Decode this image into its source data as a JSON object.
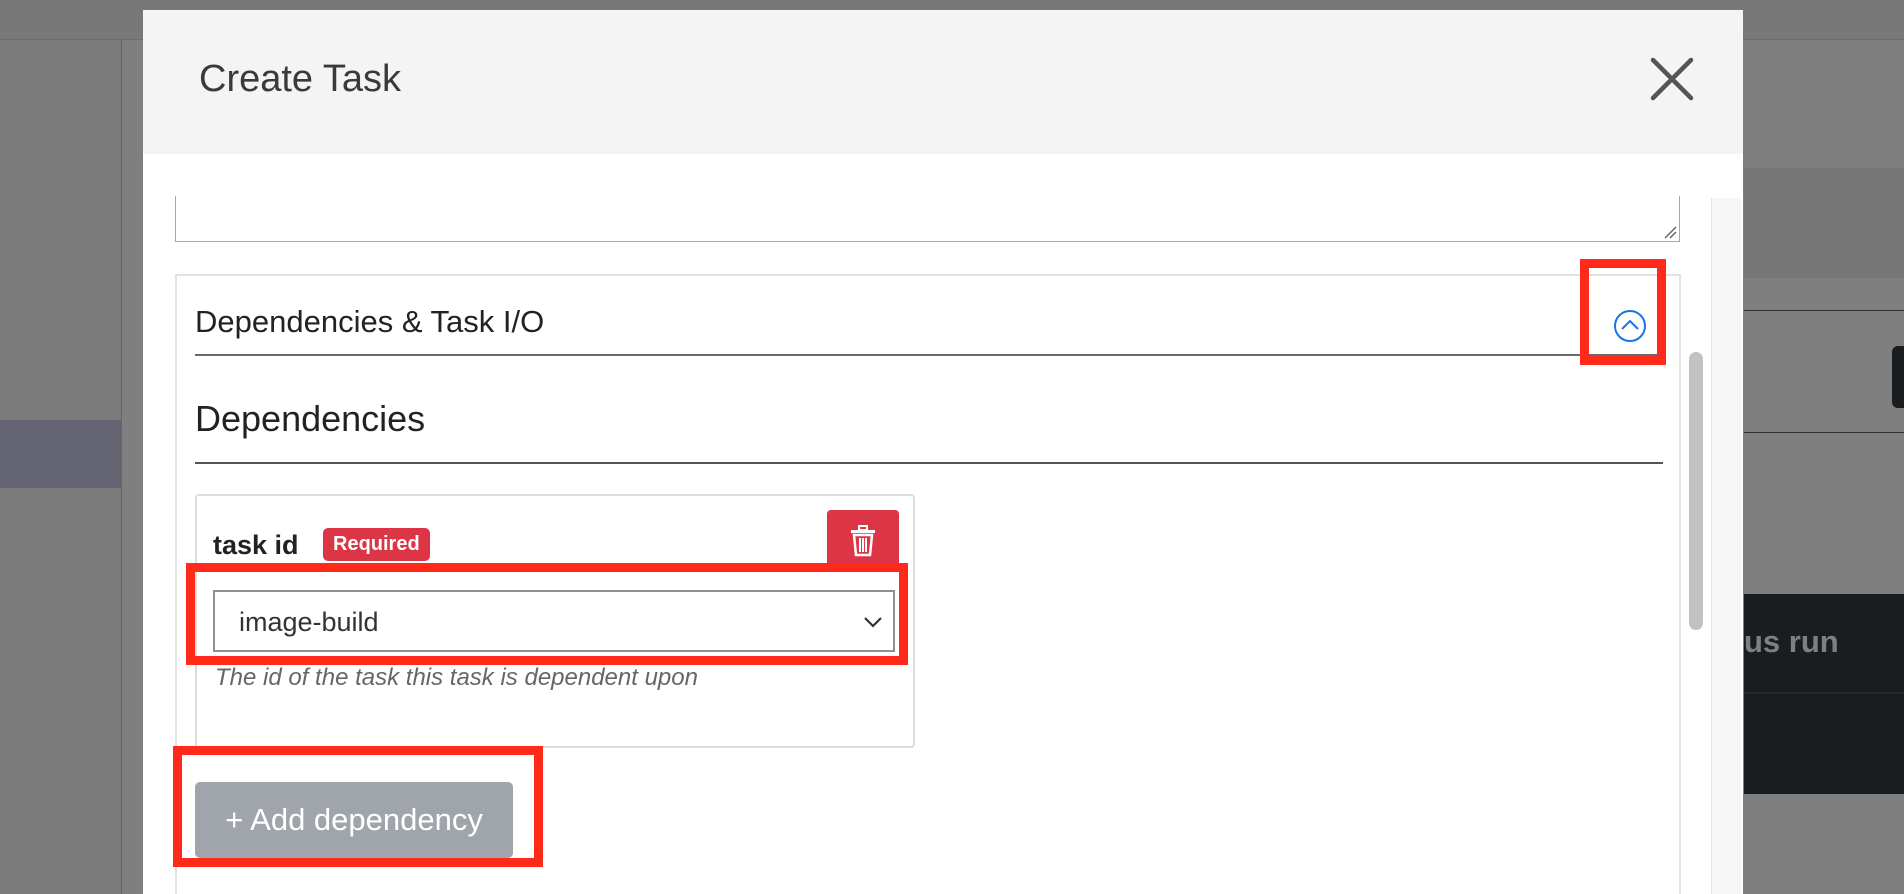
{
  "background": {
    "right_panel_text": "us run"
  },
  "modal": {
    "title": "Create Task",
    "close_icon": "close-icon",
    "section": {
      "title": "Dependencies & Task I/O",
      "toggle_icon": "chevron-up-circle-icon",
      "dependencies": {
        "title": "Dependencies",
        "items": [
          {
            "label": "task id",
            "badge": "Required",
            "delete_icon": "trash-icon",
            "selected_value": "image-build",
            "help_text": "The id of the task this task is dependent upon"
          }
        ],
        "add_label": "+ Add dependency"
      }
    }
  },
  "colors": {
    "danger": "#dc3545",
    "secondary": "#9fa5aa",
    "highlight": "#ff2a1a",
    "link_blue": "#1a73e8"
  }
}
